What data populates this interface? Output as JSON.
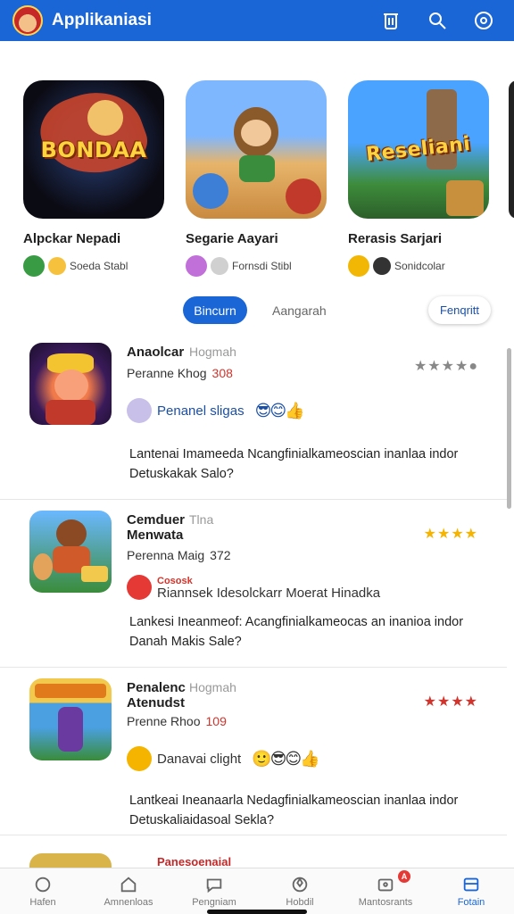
{
  "header": {
    "title": "Applikaniasi",
    "icons": [
      "avatar",
      "trash-icon",
      "search-icon",
      "settings-icon"
    ]
  },
  "featured": [
    {
      "logo": "BONDAA",
      "name": "Alpckar Nepadi",
      "meta": "Soeda Stabl",
      "color": "#0b0b14"
    },
    {
      "logo": "",
      "name": "Segarie Aayari",
      "meta": "Fornsdi Stibl",
      "color": "#e7b46b"
    },
    {
      "logo": "Reseliani",
      "name": "Rerasis Sarjari",
      "meta": "Sonidcolar",
      "color": "#4aa3ff"
    }
  ],
  "tabs": {
    "active": "Bincurn",
    "second": "Aangarah",
    "filter": "Fenqritt"
  },
  "list": [
    {
      "title": "Anaolcar",
      "title_extra": "Hogmah",
      "sub": "Peranne Khog",
      "num": "308",
      "stars": "★★★★●",
      "react_text": "Penanel sligas",
      "desc": "Lantenai Imameeda Ncangfinialkameoscian inanlaa indor Detuskakak Salo?"
    },
    {
      "title": "Cemduer Menwata",
      "title_extra": "Tlna",
      "sub": "Perenna Maig",
      "num": "372",
      "stars": "★★★★",
      "react_tag": "Cososk",
      "react_text": "Riannsek Idesolckarr Moerat Hinadka",
      "desc": "Lankesi Ineanmeof: Acangfinialkameocas an inanioa indor Danah Makis Sale?"
    },
    {
      "title": "Penalenc Atenudst",
      "title_extra": "Hogmah",
      "sub": "Prenne Rhoo",
      "num": "109",
      "stars": "★★★★",
      "react_text": "Danavai clight",
      "desc": "Lantkeai Ineanaarla Nedagfinialkameoscian inanlaa indor Detuskaliaidasoal Sekla?"
    }
  ],
  "partial_label": "Panesoenaial",
  "bottom_nav": [
    {
      "label": "Hafen",
      "icon": "home-circle-icon"
    },
    {
      "label": "Amnenloas",
      "icon": "house-icon"
    },
    {
      "label": "Pengniam",
      "icon": "chat-icon"
    },
    {
      "label": "Hobdil",
      "icon": "games-icon"
    },
    {
      "label": "Mantosrants",
      "icon": "notifications-icon",
      "badge": "A"
    },
    {
      "label": "Fotain",
      "icon": "library-icon"
    }
  ],
  "colors": {
    "accent": "#1a66d6",
    "rating_red": "#d0342c",
    "star_gold": "#f4b400"
  }
}
